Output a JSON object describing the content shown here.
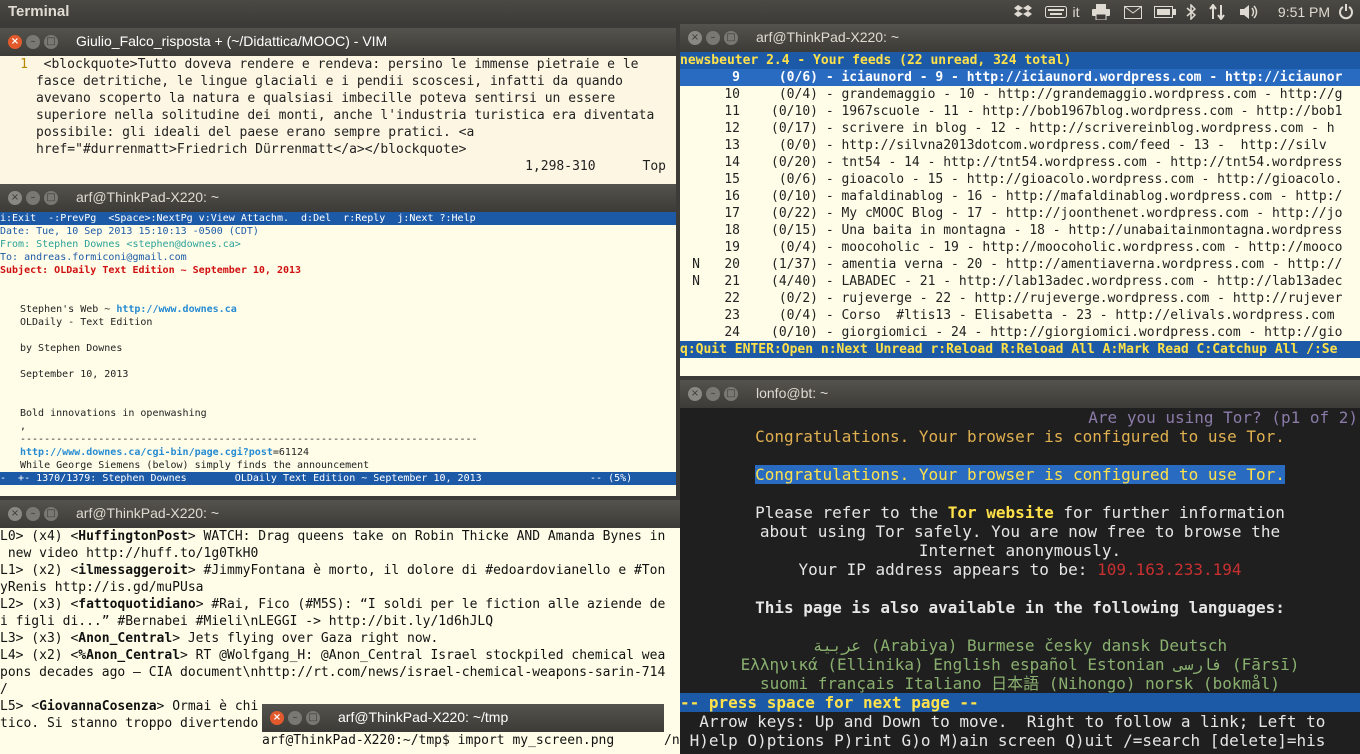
{
  "top_panel": {
    "app_title": "Terminal",
    "keyboard_layout": "it",
    "clock": "9:51 PM",
    "icons": [
      "dropbox-icon",
      "keyboard-icon",
      "printer-icon",
      "mail-icon",
      "battery-icon",
      "bluetooth-icon",
      "network-icon",
      "volume-icon",
      "power-icon"
    ]
  },
  "vim": {
    "title": "Giulio_Falco_risposta + (~/Didattica/MOOC) - VIM",
    "line_number": "1",
    "lines": [
      "<blockquote>Tutto doveva rendere e rendeva: persino le immense pietraie e le",
      "fasce detritiche, le lingue glaciali e i pendii scoscesi, infatti da quando",
      "avevano scoperto la natura e qualsiasi imbecille poteva sentirsi un essere",
      "superiore nella solitudine dei monti, anche l'industria turistica era diventata",
      "possibile: gli ideali del paese erano sempre pratici. <a",
      "href=\"#durrenmatt>Friedrich Dürrenmatt</a></blockquote>"
    ],
    "ruler": "1,298-310      Top"
  },
  "mutt": {
    "title": "arf@ThinkPad-X220: ~",
    "help_bar": "i:Exit  -:PrevPg  <Space>:NextPg v:View Attachm.  d:Del  r:Reply  j:Next ?:Help",
    "date": "Date: Tue, 10 Sep 2013 15:10:13 -0500 (CDT)",
    "from": "From: Stephen Downes <stephen@downes.ca>",
    "to": "To: andreas.formiconi@gmail.com",
    "subject": "Subject: OLDaily Text Edition ~ September 10, 2013",
    "body_web_label": "Stephen's Web ~ ",
    "body_web_link": "http://www.downes.ca",
    "body_1": "OLDaily - Text Edition",
    "body_2": "by Stephen Downes",
    "body_3": "September 10, 2013",
    "body_4": "Bold innovations in openwashing",
    "body_5": ",",
    "divider": "----------------------------------------------------------------------------",
    "post_link": "http://www.downes.ca/cgi-bin/page.cgi?post",
    "post_id": "=61124",
    "body_6": "While George Siemens (below) simply finds the announcement",
    "status_bar": "-  +- 1370/1379: Stephen Downes        OLDaily Text Edition ~ September 10, 2013                  -- (5%)"
  },
  "news": {
    "title": "arf@ThinkPad-X220: ~",
    "header": "newsbeuter 2.4 - Your feeds (22 unread, 324 total)",
    "feeds": [
      {
        "flag": " ",
        "num": "9",
        "count": "(0/6)",
        "name": "iciaunord - 9 - http://iciaunord.wordpress.com - http://iciaunor",
        "selected": true
      },
      {
        "flag": " ",
        "num": "10",
        "count": "(0/4)",
        "name": "grandemaggio - 10 - http://grandemaggio.wordpress.com - http://g",
        "selected": false
      },
      {
        "flag": " ",
        "num": "11",
        "count": "(0/10)",
        "name": "1967scuole - 11 - http://bob1967blog.wordpress.com - http://bob1",
        "selected": false
      },
      {
        "flag": " ",
        "num": "12",
        "count": "(0/17)",
        "name": "scrivere in blog - 12 - http://scrivereinblog.wordpress.com - h",
        "selected": false
      },
      {
        "flag": " ",
        "num": "13",
        "count": "(0/0)",
        "name": "http://silvna2013dotcom.wordpress.com/feed - 13 -  http://silv",
        "selected": false
      },
      {
        "flag": " ",
        "num": "14",
        "count": "(0/20)",
        "name": "tnt54 - 14 - http://tnt54.wordpress.com - http://tnt54.wordpress",
        "selected": false
      },
      {
        "flag": " ",
        "num": "15",
        "count": "(0/6)",
        "name": "gioacolo - 15 - http://gioacolo.wordpress.com - http://gioacolo.",
        "selected": false
      },
      {
        "flag": " ",
        "num": "16",
        "count": "(0/10)",
        "name": "mafaldinablog - 16 - http://mafaldinablog.wordpress.com - http:/",
        "selected": false
      },
      {
        "flag": " ",
        "num": "17",
        "count": "(0/22)",
        "name": "My cMOOC Blog - 17 - http://joonthenet.wordpress.com - http://jo",
        "selected": false
      },
      {
        "flag": " ",
        "num": "18",
        "count": "(0/15)",
        "name": "Una baita in montagna - 18 - http://unabaitainmontagna.wordpress",
        "selected": false
      },
      {
        "flag": " ",
        "num": "19",
        "count": "(0/4)",
        "name": "moocoholic - 19 - http://moocoholic.wordpress.com - http://mooco",
        "selected": false
      },
      {
        "flag": "N",
        "num": "20",
        "count": "(1/37)",
        "name": "amentia verna - 20 - http://amentiaverna.wordpress.com - http://",
        "selected": false
      },
      {
        "flag": "N",
        "num": "21",
        "count": "(4/40)",
        "name": "LABADEC - 21 - http://lab13adec.wordpress.com - http://lab13adec",
        "selected": false
      },
      {
        "flag": " ",
        "num": "22",
        "count": "(0/2)",
        "name": "rujeverge - 22 - http://rujeverge.wordpress.com - http://rujever",
        "selected": false
      },
      {
        "flag": " ",
        "num": "23",
        "count": "(0/4)",
        "name": "Corso  #ltis13 - Elisabetta - 23 - http://elivals.wordpress.com",
        "selected": false
      },
      {
        "flag": " ",
        "num": "24",
        "count": "(0/10)",
        "name": "giorgiomici - 24 - http://giorgiomici.wordpress.com - http://gio",
        "selected": false
      }
    ],
    "footer": "q:Quit ENTER:Open n:Next Unread r:Reload R:Reload All A:Mark Read C:Catchup All /:Se"
  },
  "irc": {
    "title": "arf@ThinkPad-X220: ~",
    "lines": [
      {
        "pre": "L0> (x4) <",
        "nick": "HuffingtonPost",
        "post": "> WATCH: Drag queens take on Robin Thicke AND Amanda Bynes in"
      },
      {
        "pre": " new video http://huff.to/1g0TkH0",
        "nick": "",
        "post": ""
      },
      {
        "pre": "L1> (x2) <",
        "nick": "ilmessaggeroit",
        "post": "> #JimmyFontana è morto, il dolore di #edoardovianello e #Ton"
      },
      {
        "pre": "yRenis http://is.gd/muPUsa",
        "nick": "",
        "post": ""
      },
      {
        "pre": "L2> (x3) <",
        "nick": "fattoquotidiano",
        "post": "> #Rai, Fico (#M5S): “I soldi per le fiction alle aziende de"
      },
      {
        "pre": "i figli di...” #Bernabei #Mieli\\nLEGGI -> http://bit.ly/1d6hJLQ",
        "nick": "",
        "post": ""
      },
      {
        "pre": "L3> (x3) <",
        "nick": "Anon_Central",
        "post": "> Jets flying over Gaza right now."
      },
      {
        "pre": "L4> (x2) <",
        "nick": "%Anon_Central",
        "post": "> RT @Wolfgang_H: @Anon_Central Israel stockpiled chemical wea"
      },
      {
        "pre": "pons decades ago – CIA document\\nhttp://rt.com/news/israel-chemical-weapons-sarin-714",
        "nick": "",
        "post": ""
      },
      {
        "pre": "/",
        "nick": "",
        "post": ""
      },
      {
        "pre": "L5> <",
        "nick": "GiovannaCosenza",
        "post": "> Ormai è chi"
      },
      {
        "pre": "tico. Si stanno troppo divertendo",
        "nick": "",
        "post": ""
      }
    ],
    "tail_fragment_1": "/n",
    "tail_fragment_2": "r"
  },
  "tor": {
    "title": "lonfo@bt: ~",
    "header_question": "Are you using Tor? (p1 of 2)",
    "congrats_1": "Congratulations. Your browser is configured to use Tor.",
    "congrats_2": "Congratulations. Your browser is configured to use Tor.",
    "refer_pre": "Please refer to the ",
    "refer_link": "Tor website",
    "refer_post": " for further information",
    "line_2": "about using Tor safely. You are now free to browse the",
    "line_3": "Internet anonymously.",
    "ip_label": "Your IP address appears to be: ",
    "ip_value": "109.163.233.194",
    "languages_heading": "This page is also available in the following languages:",
    "lang_line_1": "عربية (Arabiya) Burmese česky dansk Deutsch",
    "lang_line_2": "Ελληνικά (Ellinika) English español Estonian فارسی (Fārsī)",
    "lang_line_3": "suomi français Italiano 日本語 (Nihongo) norsk (bokmål)",
    "pager_status": "-- press space for next page --",
    "help_1": "  Arrow keys: Up and Down to move.  Right to follow a link; Left to",
    "help_2": " H)elp O)ptions P)rint G)o M)ain screen Q)uit /=search [delete]=his"
  },
  "tmp": {
    "title": "arf@ThinkPad-X220: ~/tmp",
    "prompt_line": "arf@ThinkPad-X220:~/tmp$ import my_screen.png"
  }
}
